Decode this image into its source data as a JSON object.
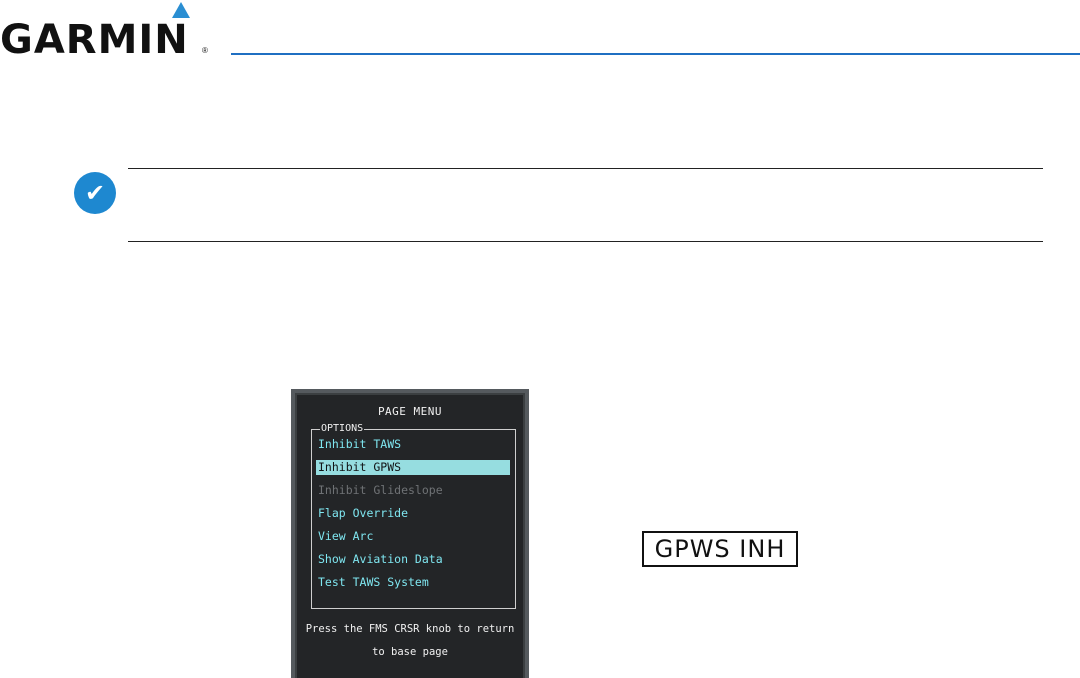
{
  "header": {
    "brand": "GARMIN",
    "registered": "®"
  },
  "note": {
    "icon": "checkmark-icon",
    "glyph": "✔"
  },
  "page_menu": {
    "title": "PAGE MENU",
    "options_label": "OPTIONS",
    "items": [
      {
        "label": "Inhibit TAWS",
        "state": "normal"
      },
      {
        "label": "Inhibit GPWS",
        "state": "selected"
      },
      {
        "label": "Inhibit Glideslope",
        "state": "disabled"
      },
      {
        "label": "Flap Override",
        "state": "normal"
      },
      {
        "label": "View Arc",
        "state": "normal"
      },
      {
        "label": "Show Aviation Data",
        "state": "normal"
      },
      {
        "label": "Test TAWS System",
        "state": "normal"
      }
    ],
    "footer_line1": "Press the FMS CRSR knob to return",
    "footer_line2": "to base page"
  },
  "annunciator": {
    "text": "GPWS INH"
  },
  "colors": {
    "accent": "#1f6fc2",
    "menu_text": "#7fe6f0",
    "selection": "#96dde0"
  }
}
